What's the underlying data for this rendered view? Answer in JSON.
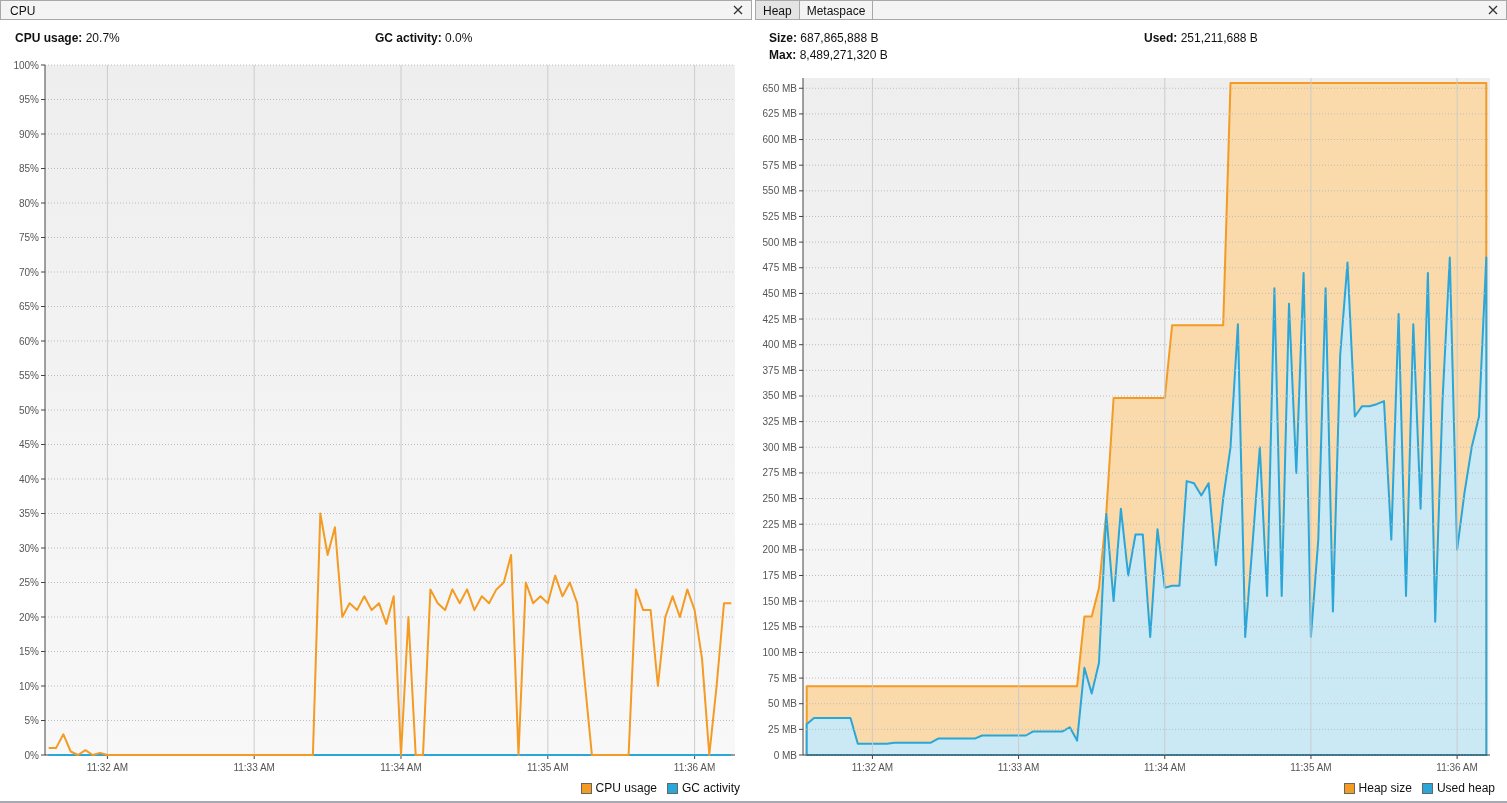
{
  "cpu_panel": {
    "title": "CPU",
    "stats": [
      "**CPU usage:** 20.7%",
      "**GC activity:** 0.0%"
    ],
    "chart_data": {
      "type": "line",
      "grid": true,
      "ylim": [
        0,
        100
      ],
      "categories": [
        null,
        null,
        null,
        null,
        null,
        null,
        null,
        null,
        "11:32 AM",
        null,
        null,
        null,
        null,
        null,
        null,
        null,
        null,
        null,
        null,
        null,
        null,
        null,
        null,
        null,
        null,
        null,
        null,
        null,
        "11:33 AM",
        null,
        null,
        null,
        null,
        null,
        null,
        null,
        null,
        null,
        null,
        null,
        null,
        null,
        null,
        null,
        null,
        null,
        null,
        null,
        "11:34 AM",
        null,
        null,
        null,
        null,
        null,
        null,
        null,
        null,
        null,
        null,
        null,
        null,
        null,
        null,
        null,
        null,
        null,
        null,
        null,
        "11:35 AM",
        null,
        null,
        null,
        null,
        null,
        null,
        null,
        null,
        null,
        null,
        null,
        null,
        null,
        null,
        null,
        null,
        null,
        null,
        null,
        "11:36 AM",
        null,
        null,
        null,
        null,
        null
      ],
      "yticks": [
        {
          "value": 0,
          "label": "0%"
        },
        {
          "value": 5,
          "label": "5%"
        },
        {
          "value": 10,
          "label": "10%"
        },
        {
          "value": 15,
          "label": "15%"
        },
        {
          "value": 20,
          "label": "20%"
        },
        {
          "value": 25,
          "label": "25%"
        },
        {
          "value": 30,
          "label": "30%"
        },
        {
          "value": 35,
          "label": "35%"
        },
        {
          "value": 40,
          "label": "40%"
        },
        {
          "value": 45,
          "label": "45%"
        },
        {
          "value": 50,
          "label": "50%"
        },
        {
          "value": 55,
          "label": "55%"
        },
        {
          "value": 60,
          "label": "60%"
        },
        {
          "value": 65,
          "label": "65%"
        },
        {
          "value": 70,
          "label": "70%"
        },
        {
          "value": 75,
          "label": "75%"
        },
        {
          "value": 80,
          "label": "80%"
        },
        {
          "value": 85,
          "label": "85%"
        },
        {
          "value": 90,
          "label": "90%"
        },
        {
          "value": 95,
          "label": "95%"
        },
        {
          "value": 100,
          "label": "100%"
        }
      ],
      "series": [
        {
          "name": "CPU usage",
          "color": "#f39b23",
          "values": [
            1,
            1,
            3,
            0.5,
            0,
            0.7,
            0,
            0.3,
            0,
            0,
            0,
            0,
            0,
            0,
            0,
            0,
            0,
            0,
            0,
            0,
            0,
            0,
            0,
            0,
            0,
            0,
            0,
            0,
            0,
            0,
            0,
            0,
            0,
            0,
            0,
            0,
            0,
            35,
            29,
            33,
            20,
            22,
            21,
            23,
            21,
            22,
            19,
            23,
            0,
            20,
            0,
            0,
            24,
            22,
            21,
            24,
            22,
            24,
            21,
            23,
            22,
            24,
            25,
            29,
            0,
            25,
            22,
            23,
            22,
            26,
            23,
            25,
            22,
            11,
            0,
            0,
            0,
            0,
            0,
            0,
            24,
            21,
            21,
            10,
            20,
            23,
            20,
            24,
            21,
            14,
            0,
            10,
            22,
            22
          ]
        },
        {
          "name": "GC activity",
          "color": "#2aa6d8",
          "values": [
            0,
            0,
            0,
            0,
            0,
            0,
            0,
            0,
            0,
            0,
            0,
            0,
            0,
            0,
            0,
            0,
            0,
            0,
            0,
            0,
            0,
            0,
            0,
            0,
            0,
            0,
            0,
            0,
            0,
            0,
            0,
            0,
            0,
            0,
            0,
            0,
            0,
            0,
            0,
            0,
            0,
            0,
            0,
            0,
            0,
            0,
            0,
            0,
            0,
            0,
            0,
            0,
            0,
            0,
            0,
            0,
            0,
            0,
            0,
            0,
            0,
            0,
            0,
            0,
            0,
            0,
            0,
            0,
            0,
            0,
            0,
            0,
            0,
            0,
            0,
            0,
            0,
            0,
            0,
            0,
            0,
            0,
            0,
            0,
            0,
            0,
            0,
            0,
            0,
            0,
            0,
            0,
            0,
            0
          ]
        }
      ]
    }
  },
  "heap_panel": {
    "tabs": [
      {
        "label": "Heap",
        "selected": true
      },
      {
        "label": "Metaspace",
        "selected": false
      }
    ],
    "stats": [
      "**Size:** 687,865,888 B",
      "**Used:** 251,211,688 B",
      "**Max:** 8,489,271,320 B"
    ],
    "chart_data": {
      "type": "area",
      "stacked": false,
      "grid": true,
      "ylim": [
        0,
        660
      ],
      "categories": [
        null,
        null,
        null,
        null,
        null,
        null,
        null,
        null,
        null,
        "11:32 AM",
        null,
        null,
        null,
        null,
        null,
        null,
        null,
        null,
        null,
        null,
        null,
        null,
        null,
        null,
        null,
        null,
        null,
        null,
        null,
        "11:33 AM",
        null,
        null,
        null,
        null,
        null,
        null,
        null,
        null,
        null,
        null,
        null,
        null,
        null,
        null,
        null,
        null,
        null,
        null,
        null,
        "11:34 AM",
        null,
        null,
        null,
        null,
        null,
        null,
        null,
        null,
        null,
        null,
        null,
        null,
        null,
        null,
        null,
        null,
        null,
        null,
        null,
        "11:35 AM",
        null,
        null,
        null,
        null,
        null,
        null,
        null,
        null,
        null,
        null,
        null,
        null,
        null,
        null,
        null,
        null,
        null,
        null,
        null,
        "11:36 AM",
        null,
        null,
        null,
        null
      ],
      "yticks": [
        {
          "value": 0,
          "label": "0 MB"
        },
        {
          "value": 25,
          "label": "25 MB"
        },
        {
          "value": 50,
          "label": "50 MB"
        },
        {
          "value": 75,
          "label": "75 MB"
        },
        {
          "value": 100,
          "label": "100 MB"
        },
        {
          "value": 125,
          "label": "125 MB"
        },
        {
          "value": 150,
          "label": "150 MB"
        },
        {
          "value": 175,
          "label": "175 MB"
        },
        {
          "value": 200,
          "label": "200 MB"
        },
        {
          "value": 225,
          "label": "225 MB"
        },
        {
          "value": 250,
          "label": "250 MB"
        },
        {
          "value": 275,
          "label": "275 MB"
        },
        {
          "value": 300,
          "label": "300 MB"
        },
        {
          "value": 325,
          "label": "325 MB"
        },
        {
          "value": 350,
          "label": "350 MB"
        },
        {
          "value": 375,
          "label": "375 MB"
        },
        {
          "value": 400,
          "label": "400 MB"
        },
        {
          "value": 425,
          "label": "425 MB"
        },
        {
          "value": 450,
          "label": "450 MB"
        },
        {
          "value": 475,
          "label": "475 MB"
        },
        {
          "value": 500,
          "label": "500 MB"
        },
        {
          "value": 525,
          "label": "525 MB"
        },
        {
          "value": 550,
          "label": "550 MB"
        },
        {
          "value": 575,
          "label": "575 MB"
        },
        {
          "value": 600,
          "label": "600 MB"
        },
        {
          "value": 625,
          "label": "625 MB"
        },
        {
          "value": 650,
          "label": "650 MB"
        }
      ],
      "series": [
        {
          "name": "Heap size",
          "color": "#f39b23",
          "values": [
            67,
            67,
            67,
            67,
            67,
            67,
            67,
            67,
            67,
            67,
            67,
            67,
            67,
            67,
            67,
            67,
            67,
            67,
            67,
            67,
            67,
            67,
            67,
            67,
            67,
            67,
            67,
            67,
            67,
            67,
            67,
            67,
            67,
            67,
            67,
            67,
            67,
            67,
            135,
            135,
            163,
            236,
            348,
            348,
            348,
            348,
            348,
            348,
            348,
            348,
            419,
            419,
            419,
            419,
            419,
            419,
            419,
            419,
            655,
            655,
            655,
            655,
            655,
            655,
            655,
            655,
            655,
            655,
            655,
            655,
            655,
            655,
            655,
            655,
            655,
            655,
            655,
            655,
            655,
            655,
            655,
            655,
            655,
            655,
            655,
            655,
            655,
            655,
            655,
            655,
            655,
            655,
            655,
            655
          ]
        },
        {
          "name": "Used heap",
          "color": "#2aa6d8",
          "values": [
            30,
            36,
            36,
            36,
            36,
            36,
            36,
            11,
            11,
            11,
            11,
            11,
            12,
            12,
            12,
            12,
            12,
            12,
            16,
            16,
            16,
            16,
            16,
            16,
            19,
            19,
            19,
            19,
            19,
            19,
            19,
            23,
            23,
            23,
            23,
            23,
            27,
            14,
            85,
            60,
            90,
            235,
            150,
            240,
            175,
            215,
            215,
            115,
            220,
            163,
            165,
            165,
            267,
            265,
            253,
            265,
            185,
            250,
            300,
            420,
            115,
            205,
            300,
            155,
            455,
            155,
            440,
            275,
            470,
            115,
            210,
            455,
            140,
            390,
            480,
            330,
            340,
            340,
            342,
            345,
            210,
            430,
            155,
            420,
            240,
            470,
            130,
            345,
            485,
            200,
            255,
            300,
            330,
            485
          ]
        }
      ]
    }
  }
}
